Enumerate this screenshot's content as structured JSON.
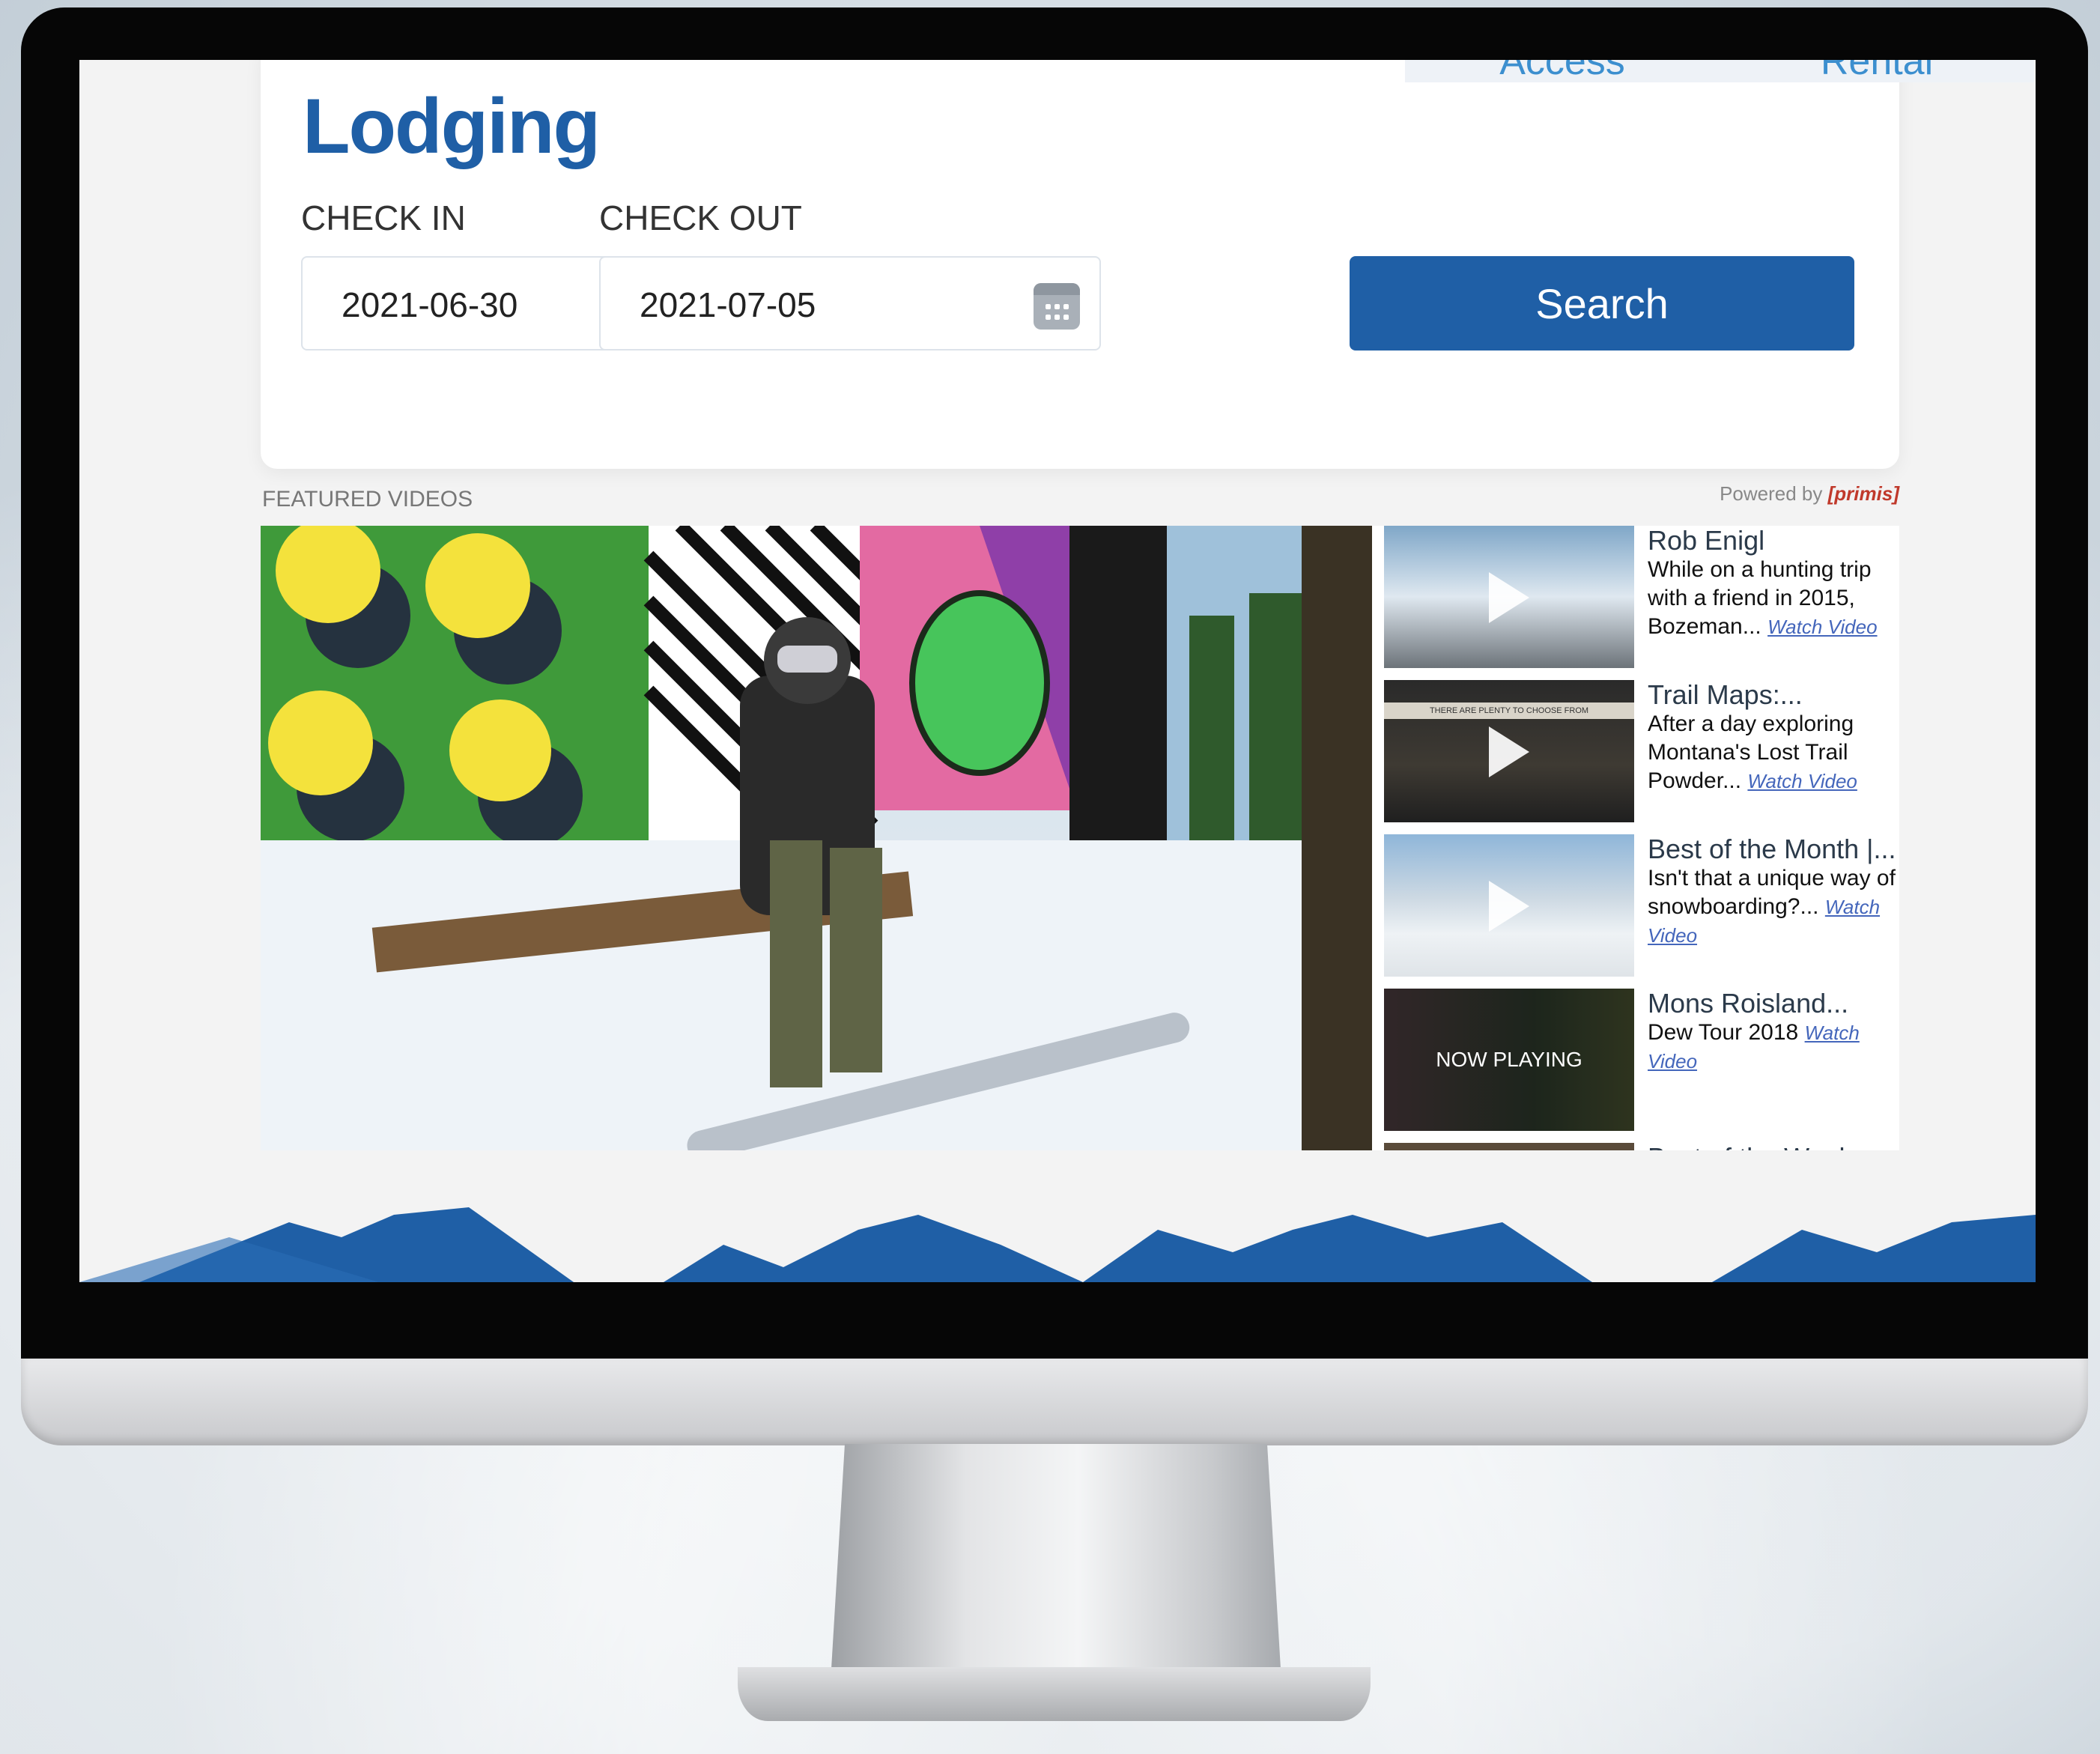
{
  "header": {
    "title": "Lodging",
    "tabs": [
      "Access",
      "Rental"
    ]
  },
  "booking": {
    "checkin_label": "CHECK IN",
    "checkin_value": "2021-06-30",
    "checkout_label": "CHECK OUT",
    "checkout_value": "2021-07-05",
    "search_label": "Search"
  },
  "videos": {
    "section_label": "FEATURED VIDEOS",
    "powered_prefix": "Powered by",
    "powered_brand": "primis",
    "playlist": [
      {
        "title": "Rob Enigl",
        "desc": "While on a hunting trip with a friend in 2015, Bozeman...",
        "link": "Watch Video"
      },
      {
        "title": "Trail Maps:...",
        "desc": "After a day exploring Montana's Lost Trail Powder...",
        "link": "Watch Video",
        "thumb_caption": "THERE ARE PLENTY TO CHOOSE FROM"
      },
      {
        "title": "Best of the Month |...",
        "desc": "Isn't that a unique way of snowboarding?...",
        "link": "Watch Video"
      },
      {
        "title": "Mons Roisland...",
        "desc": "Dew Tour 2018",
        "link": "Watch Video",
        "status": "NOW PLAYING"
      },
      {
        "title": "Best of the Week",
        "desc": "",
        "link": ""
      }
    ]
  },
  "colors": {
    "brand": "#1f5fa6",
    "accent": "#3c8fcf"
  }
}
